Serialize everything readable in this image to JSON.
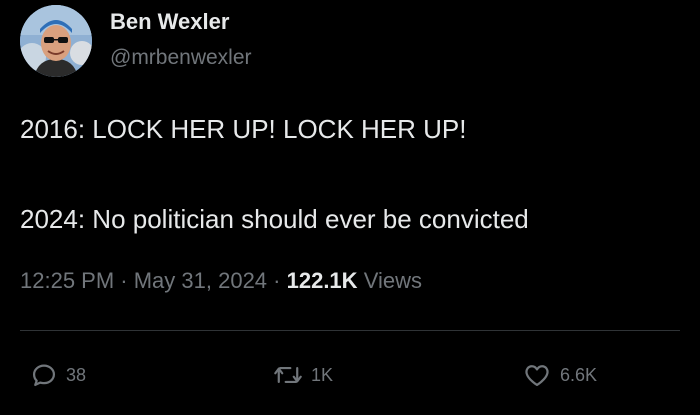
{
  "author": {
    "display_name": "Ben Wexler",
    "handle": "@mrbenwexler"
  },
  "tweet": {
    "lines": [
      "2016: LOCK HER UP! LOCK HER UP!",
      "",
      "2024: No politician should ever be convicted"
    ]
  },
  "meta": {
    "time": "12:25 PM",
    "separator": " · ",
    "date": "May 31, 2024",
    "views_count": "122.1K",
    "views_label": "Views"
  },
  "actions": {
    "reply": {
      "icon": "reply-icon",
      "count": "38"
    },
    "retweet": {
      "icon": "retweet-icon",
      "count": "1K"
    },
    "like": {
      "icon": "heart-icon",
      "count": "6.6K"
    }
  },
  "colors": {
    "background": "#000000",
    "primary_text": "#e7e9ea",
    "secondary_text": "#71767b",
    "divider": "#2f3336"
  }
}
